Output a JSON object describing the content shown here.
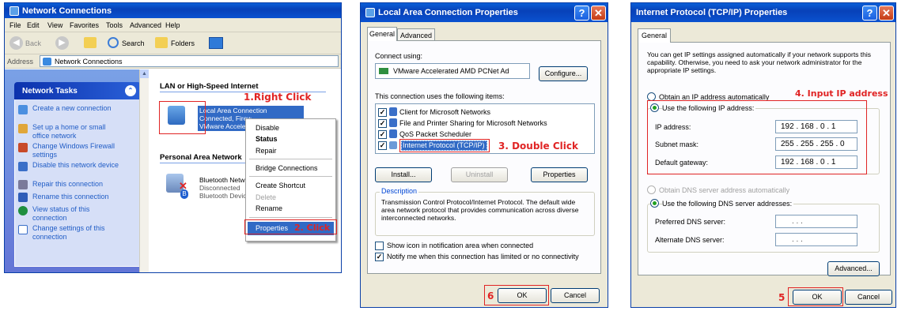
{
  "nc": {
    "title": "Network Connections",
    "menu": [
      "File",
      "Edit",
      "View",
      "Favorites",
      "Tools",
      "Advanced",
      "Help"
    ],
    "toolbar": {
      "back": "Back",
      "search": "Search",
      "folders": "Folders"
    },
    "address_label": "Address",
    "address_value": "Network Connections",
    "tasks_title": "Network Tasks",
    "tasks": [
      "Create a new connection",
      "Set up a home or small office network",
      "Change Windows Firewall settings",
      "Disable this network device",
      "Repair this connection",
      "Rename this connection",
      "View status of this connection",
      "Change settings of this connection"
    ],
    "group_lan": "LAN or High-Speed Internet",
    "lan_name": "Local Area Connection",
    "lan_status": "Connected, Firewalled",
    "lan_device": "VMware Accelerated AMD PCNet Ad",
    "group_pan": "Personal Area Network",
    "bt_name": "Bluetooth Network Connection",
    "bt_status": "Disconnected",
    "bt_device": "Bluetooth Device (Personal Area Network)",
    "context_menu": [
      "Disable",
      "Status",
      "Repair",
      "Bridge Connections",
      "Create Shortcut",
      "Delete",
      "Rename",
      "Properties"
    ],
    "annot_right_click": "1.Right Click",
    "annot_click": "2. Click"
  },
  "lacp": {
    "title": "Local Area Connection Properties",
    "tabs": [
      "General",
      "Advanced"
    ],
    "connect_using": "Connect using:",
    "adapter": "VMware Accelerated AMD PCNet Ad",
    "configure": "Configure...",
    "items_label": "This connection uses the following items:",
    "items": [
      "Client for Microsoft Networks",
      "File and Printer Sharing for Microsoft Networks",
      "QoS Packet Scheduler",
      "Internet Protocol (TCP/IP)"
    ],
    "install": "Install...",
    "uninstall": "Uninstall",
    "properties": "Properties",
    "desc_label": "Description",
    "desc_text": "Transmission Control Protocol/Internet Protocol. The default wide area network protocol that provides communication across diverse interconnected networks.",
    "show_icon": "Show icon in notification area when connected",
    "notify": "Notify me when this connection has limited or no connectivity",
    "ok": "OK",
    "cancel": "Cancel",
    "annot_double_click": "3. Double Click",
    "annot_six": "6"
  },
  "tcpip": {
    "title": "Internet Protocol (TCP/IP) Properties",
    "tab": "General",
    "intro": "You can get IP settings assigned automatically if your network supports this capability. Otherwise, you need to ask your network administrator for the appropriate IP settings.",
    "obtain_ip": "Obtain an IP address automatically",
    "use_ip": "Use the following IP address:",
    "ip_label": "IP address:",
    "ip_value": "192 . 168 .  0  .  1",
    "mask_label": "Subnet mask:",
    "mask_value": "255 . 255 . 255 .  0",
    "gw_label": "Default gateway:",
    "gw_value": "192 . 168 .  0  .  1",
    "obtain_dns": "Obtain DNS server address automatically",
    "use_dns": "Use the following DNS server addresses:",
    "pref_dns": "Preferred DNS server:",
    "alt_dns": "Alternate DNS server:",
    "empty_ip": ".        .        .",
    "advanced": "Advanced...",
    "ok": "OK",
    "cancel": "Cancel",
    "annot_input": "4. Input IP address",
    "annot_five": "5"
  }
}
